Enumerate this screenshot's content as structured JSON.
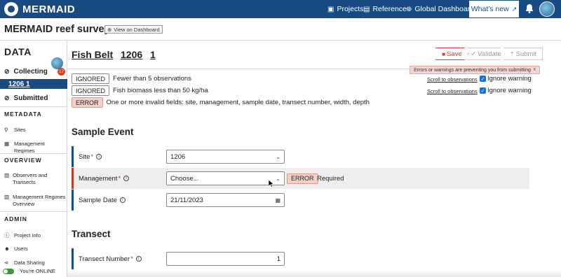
{
  "topbar": {
    "brand": "MERMAID",
    "nav": [
      {
        "label": "Projects",
        "icon": "projects-icon"
      },
      {
        "label": "Reference",
        "icon": "reference-icon"
      },
      {
        "label": "Global Dashboard",
        "icon": "globe-icon"
      }
    ],
    "whats_new": "What's new"
  },
  "project": {
    "title": "MERMAID reef survey",
    "view_dashboard": "View on Dashboard"
  },
  "sidebar": {
    "data_heading": "DATA",
    "collecting": "Collecting",
    "collecting_count": "17",
    "active_record": "1206 1",
    "submitted": "Submitted",
    "metadata_heading": "METADATA",
    "metadata_items": [
      "Sites",
      "Management Regimes"
    ],
    "overview_heading": "OVERVIEW",
    "overview_items": [
      "Observers and Transects",
      "Management Regimes Overview"
    ],
    "admin_heading": "ADMIN",
    "admin_items": [
      "Project Info",
      "Users",
      "Data Sharing"
    ],
    "online_status": "You're ONLINE"
  },
  "record": {
    "type": "Fish Belt",
    "site": "1206",
    "number": "1",
    "save": "Save",
    "validate": "Validate",
    "submit": "Submit",
    "error_banner": "Errors or warnings are preventing you from submitting",
    "error_banner_close": "x"
  },
  "messages": [
    {
      "tag": "IGNORED",
      "text": "Fewer than 5 observations",
      "link": "Scroll to observations",
      "ignore": "Ignore warning"
    },
    {
      "tag": "IGNORED",
      "text": "Fish biomass less than 50 kg/ha",
      "link": "Scroll to observations",
      "ignore": "Ignore warning"
    },
    {
      "tag": "ERROR",
      "text": "One or more invalid fields: site, management, sample date, transect number, width, depth"
    }
  ],
  "sample_event": {
    "heading": "Sample Event",
    "site_label": "Site",
    "site_value": "1206",
    "management_label": "Management",
    "management_value": "Choose...",
    "management_error": "ERROR",
    "management_error_text": "Required",
    "date_label": "Sample Date",
    "date_value": "21/11/2023"
  },
  "transect": {
    "heading": "Transect",
    "number_label": "Transect Number",
    "number_value": "1"
  }
}
